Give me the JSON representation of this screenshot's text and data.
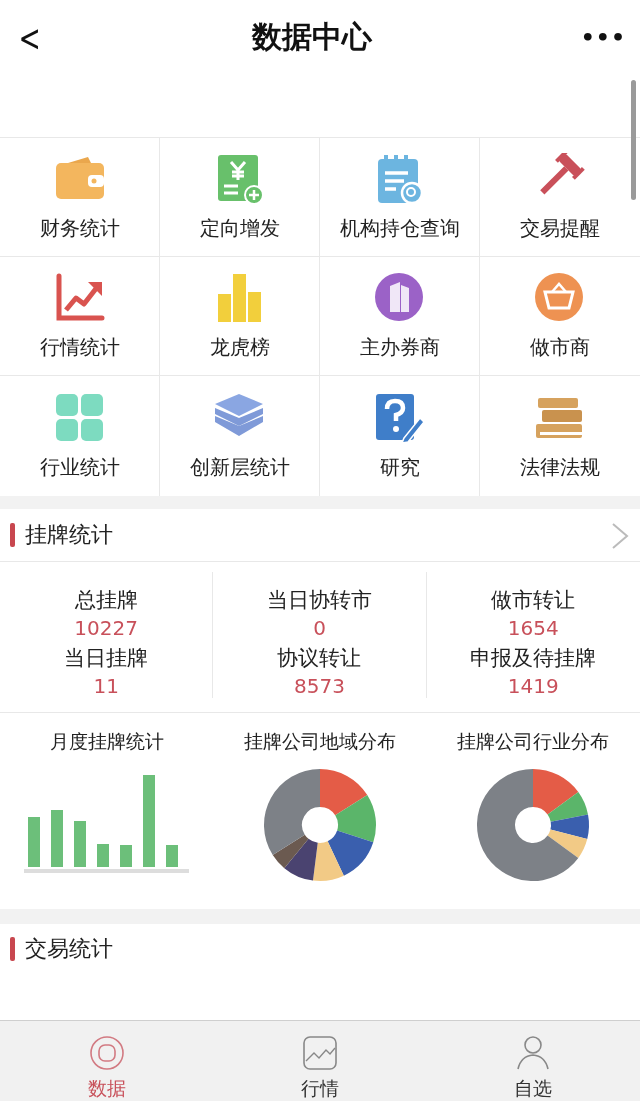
{
  "header": {
    "title": "数据中心",
    "back": "<",
    "more": "•••"
  },
  "shortcuts": [
    {
      "label": "财务统计"
    },
    {
      "label": "定向增发"
    },
    {
      "label": "机构持仓查询"
    },
    {
      "label": "交易提醒"
    },
    {
      "label": "行情统计"
    },
    {
      "label": "龙虎榜"
    },
    {
      "label": "主办券商"
    },
    {
      "label": "做市商"
    },
    {
      "label": "行业统计"
    },
    {
      "label": "创新层统计"
    },
    {
      "label": "研究"
    },
    {
      "label": "法律法规"
    }
  ],
  "listing": {
    "title": "挂牌统计",
    "stats": [
      {
        "label": "总挂牌",
        "value": "10227"
      },
      {
        "label": "当日协转市",
        "value": "0"
      },
      {
        "label": "做市转让",
        "value": "1654"
      },
      {
        "label": "当日挂牌",
        "value": "11"
      },
      {
        "label": "协议转让",
        "value": "8573"
      },
      {
        "label": "申报及待挂牌",
        "value": "1419"
      }
    ],
    "charts": [
      {
        "title": "月度挂牌统计",
        "kind": "bars"
      },
      {
        "title": "挂牌公司地域分布",
        "kind": "donut"
      },
      {
        "title": "挂牌公司行业分布",
        "kind": "donut"
      }
    ]
  },
  "trading": {
    "title": "交易统计"
  },
  "tabs": [
    {
      "label": "数据",
      "selected": true
    },
    {
      "label": "行情",
      "selected": false
    },
    {
      "label": "自选",
      "selected": false
    }
  ]
}
